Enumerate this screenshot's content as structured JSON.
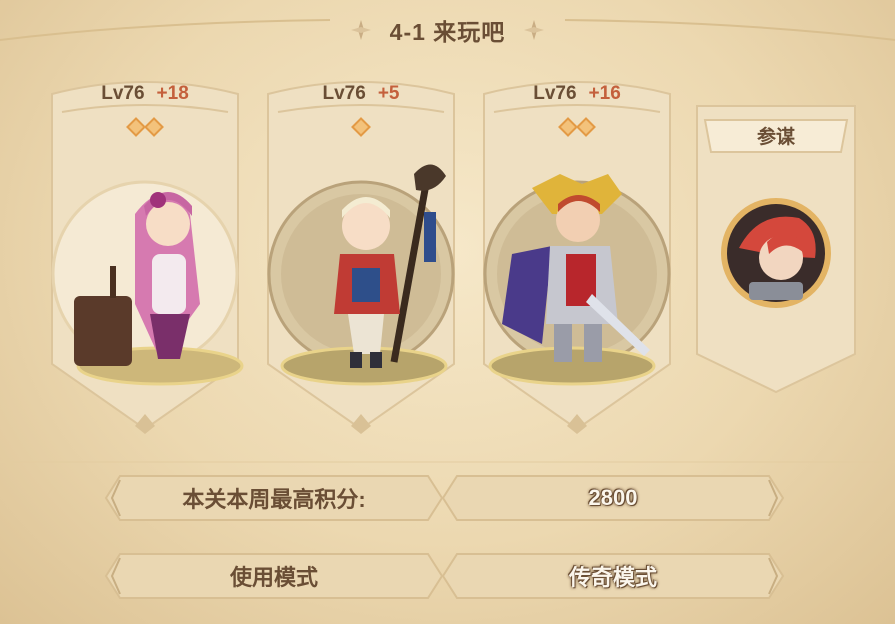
{
  "stage": {
    "title": "4-1 来玩吧"
  },
  "heroes": [
    {
      "level": "Lv76",
      "bonus": "+18",
      "stars": 2
    },
    {
      "level": "Lv76",
      "bonus": "+5",
      "stars": 1
    },
    {
      "level": "Lv76",
      "bonus": "+16",
      "stars": 2
    }
  ],
  "strategist": {
    "label": "参谋"
  },
  "score": {
    "label": "本关本周最高积分:",
    "value": "2800"
  },
  "mode": {
    "label": "使用模式",
    "value": "传奇模式"
  },
  "icons": {
    "title_left": "diamond-ornament-icon",
    "title_right": "diamond-ornament-icon",
    "star": "star-diamond-icon"
  },
  "colors": {
    "background": "#ecd8b0",
    "text_brown": "#6a4e35",
    "bonus_orange": "#c4603c",
    "star": "#f3c27b"
  }
}
